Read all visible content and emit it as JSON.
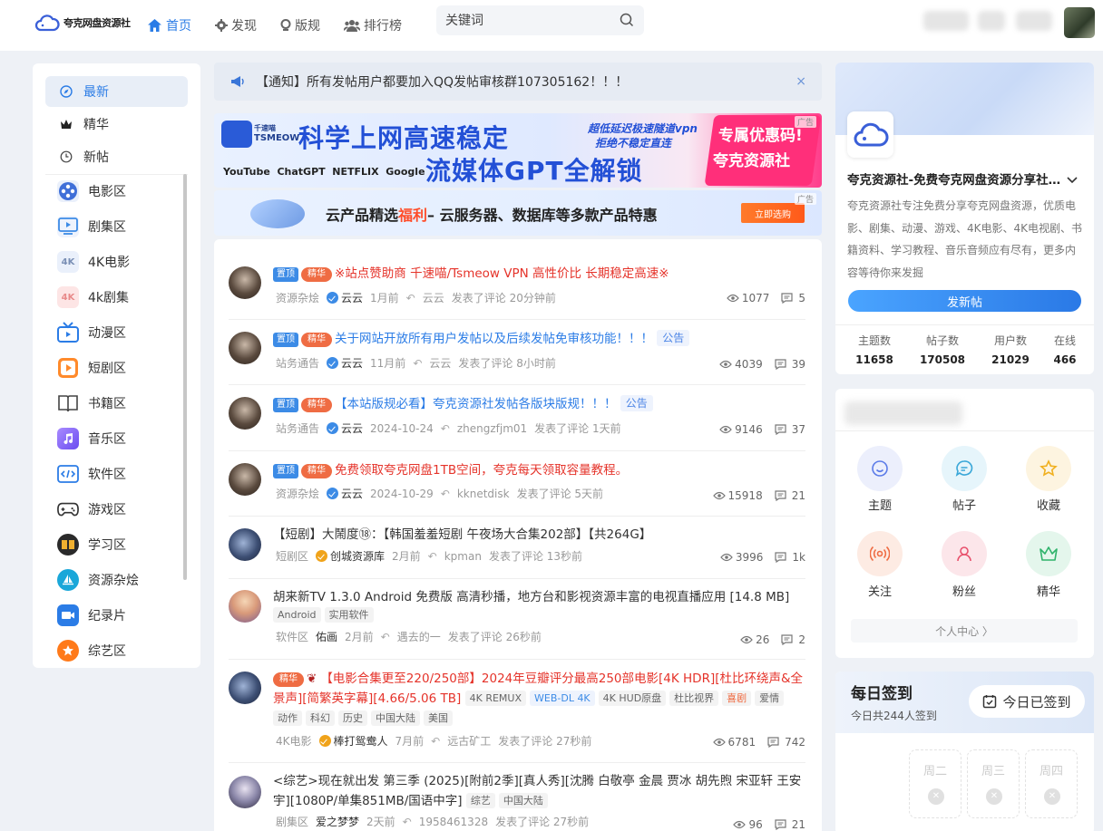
{
  "header": {
    "logo_text": "夸克网盘资源社",
    "nav": [
      {
        "label": "首页",
        "icon": "home-icon",
        "active": true
      },
      {
        "label": "发现",
        "icon": "gear-icon",
        "active": false
      },
      {
        "label": "版规",
        "icon": "pin-icon",
        "active": false
      },
      {
        "label": "排行榜",
        "icon": "users-icon",
        "active": false
      }
    ],
    "search_placeholder": "关键词"
  },
  "left_nav": {
    "items": [
      {
        "label": "最新",
        "icon": "compass-icon",
        "active": true
      },
      {
        "label": "精华",
        "icon": "crown-icon",
        "active": false
      },
      {
        "label": "新帖",
        "icon": "clock-icon",
        "active": false
      }
    ],
    "categories": [
      {
        "label": "电影区",
        "icon": "film-reel-icon",
        "color": "#3f6fd8"
      },
      {
        "label": "剧集区",
        "icon": "tv-play-icon",
        "color": "#3c8be6"
      },
      {
        "label": "4K电影",
        "icon": "4k-icon",
        "icon_text": "4K",
        "color": "#eaf0fb"
      },
      {
        "label": "4k剧集",
        "icon": "4k-red-icon",
        "icon_text": "4K",
        "color": "#fde5e5"
      },
      {
        "label": "动漫区",
        "icon": "tv-anime-icon",
        "color": "#2b7ce6"
      },
      {
        "label": "短剧区",
        "icon": "play-square-icon",
        "color": "#ff8a2b"
      },
      {
        "label": "书籍区",
        "icon": "book-icon",
        "color": "#444444"
      },
      {
        "label": "音乐区",
        "icon": "music-icon",
        "color": "#7b5cf0"
      },
      {
        "label": "软件区",
        "icon": "code-icon",
        "color": "#2b7ce6"
      },
      {
        "label": "游戏区",
        "icon": "gamepad-icon",
        "color": "#333333"
      },
      {
        "label": "学习区",
        "icon": "open-book-icon",
        "color": "#2a2a2a"
      },
      {
        "label": "资源杂烩",
        "icon": "sailboat-icon",
        "color": "#1aa7d9"
      },
      {
        "label": "纪录片",
        "icon": "video-camera-icon",
        "color": "#2b7ce6"
      },
      {
        "label": "综艺区",
        "icon": "star-icon",
        "color": "#ff7a1a"
      }
    ]
  },
  "notice": {
    "text": "【通知】所有发帖用户都要加入QQ发帖审核群107305162！！！",
    "close": "×"
  },
  "banner1": {
    "brand_line1": "千速喵",
    "brand_line2": "TSMEOW",
    "headline1": "科学上网高速稳定",
    "headline2": "流媒体GPT全解锁",
    "sub1": "超低延迟极速隧道vpn",
    "sub2": "拒绝不稳定直连",
    "promo1": "专属优惠码!",
    "promo2": "夸克资源社",
    "services": "YouTube  ChatGPT  NETFLIX  Google",
    "ad": "广告"
  },
  "banner2": {
    "text_a": "云产品精选",
    "text_hl": "福利",
    "text_b": "– 云服务器、数据库等多款产品特惠",
    "button": "立即选购",
    "ad": "广告"
  },
  "posts": [
    {
      "badges": [
        "置顶",
        "精华"
      ],
      "title": "※站点赞助商 千速喵/Tsmeow VPN 高性价比 长期稳定高速※",
      "red": true,
      "category": "资源杂烩",
      "author": "云云",
      "time": "1月前",
      "replier": "云云",
      "reply_text": "发表了评论 20分钟前",
      "views": "1077",
      "comments": "5"
    },
    {
      "badges": [
        "置顶",
        "精华"
      ],
      "title": "关于网站开放所有用户发帖以及后续发帖免审核功能！！！",
      "label": "公告",
      "category": "站务通告",
      "author": "云云",
      "time": "11月前",
      "replier": "云云",
      "reply_text": "发表了评论 8小时前",
      "views": "4039",
      "comments": "39"
    },
    {
      "badges": [
        "置顶",
        "精华"
      ],
      "title": "【本站版规必看】夸克资源社发帖各版块版规！！！",
      "label": "公告",
      "category": "站务通告",
      "author": "云云",
      "time": "2024-10-24",
      "replier": "zhengzfjm01",
      "reply_text": "发表了评论 1天前",
      "views": "9146",
      "comments": "37"
    },
    {
      "badges": [
        "置顶",
        "精华"
      ],
      "title": "免费领取夸克网盘1TB空间，夸克每天领取容量教程。",
      "red": true,
      "category": "资源杂烩",
      "author": "云云",
      "time": "2024-10-29",
      "replier": "kknetdisk",
      "reply_text": "发表了评论 5天前",
      "views": "15918",
      "comments": "21"
    },
    {
      "badges": [],
      "title": "【短剧】大鬧度⑱：【韩国羞羞短剧 午夜场大合集202部】【共264G】",
      "category": "短剧区",
      "author": "创城资源库",
      "time": "2月前",
      "replier": "kpman",
      "reply_text": "发表了评论 13秒前",
      "views": "3996",
      "comments": "1k"
    },
    {
      "badges": [],
      "title": "胡来新TV 1.3.0 Android 免费版 高清秒播，地方台和影视资源丰富的电视直播应用 [14.8 MB]",
      "tags": [
        "Android",
        "实用软件"
      ],
      "category": "软件区",
      "author": "佑画",
      "time": "2月前",
      "replier": "遇去的一",
      "reply_text": "发表了评论 26秒前",
      "views": "26",
      "comments": "2"
    },
    {
      "badges": [
        "精华"
      ],
      "title_line1": "【电影合集更至220/250部】2024年豆瓣评分最高250部电影[4K HDR][杜比环绕声&全",
      "title_line2": "景声][简繁英字幕][4.66/5.06 TB]",
      "tags_inline": [
        "4K REMUX",
        "WEB-DL 4K",
        "4K HUD原盘",
        "杜比视界",
        "喜剧",
        "爱情"
      ],
      "tags": [
        "动作",
        "科幻",
        "历史",
        "中国大陆",
        "美国"
      ],
      "category": "4K电影",
      "author": "棒打鸳鸯人",
      "time": "7月前",
      "replier": "远古矿工",
      "reply_text": "发表了评论 27秒前",
      "views": "6781",
      "comments": "742"
    },
    {
      "badges": [],
      "title_line1": "<综艺>现在就出发 第三季 (2025)[附前2季][真人秀][沈腾 白敬亭 金晨 贾冰 胡先煦 宋亚轩 王安",
      "title_line2": "宇][1080P/单集851MB/国语中字]",
      "tags_inline": [
        "综艺",
        "中国大陆"
      ],
      "category": "剧集区",
      "author": "爱之梦梦",
      "time": "2天前",
      "replier": "1958461328",
      "reply_text": "发表了评论 27秒前",
      "views": "96",
      "comments": "21"
    }
  ],
  "site_card": {
    "title": "夸克资源社-免费夸克网盘资源分享社…",
    "desc": "夸克资源社专注免费分享夸克网盘资源，优质电影、剧集、动漫、游戏、4K电影、4K电视剧、书籍资料、学习教程、音乐音频应有尽有，更多内容等待你来发掘",
    "button": "发新帖",
    "stats": [
      {
        "label": "主题数",
        "value": "11658"
      },
      {
        "label": "帖子数",
        "value": "170508"
      },
      {
        "label": "用户数",
        "value": "21029"
      },
      {
        "label": "在线",
        "value": "466"
      }
    ]
  },
  "user_card": {
    "items": [
      {
        "label": "主题",
        "icon": "smile-icon",
        "color": "#5b7be8",
        "bg": "#eceffc"
      },
      {
        "label": "帖子",
        "icon": "chat-icon",
        "color": "#3aa7d8",
        "bg": "#e6f5fb"
      },
      {
        "label": "收藏",
        "icon": "star-icon",
        "color": "#f0b020",
        "bg": "#fdf4e0"
      },
      {
        "label": "关注",
        "icon": "radio-icon",
        "color": "#ef6c43",
        "bg": "#fdebe3"
      },
      {
        "label": "粉丝",
        "icon": "user-icon",
        "color": "#e8506b",
        "bg": "#fce6ea"
      },
      {
        "label": "精华",
        "icon": "crown-icon",
        "color": "#2fb36b",
        "bg": "#e4f6ec"
      }
    ],
    "center": "个人中心 〉"
  },
  "checkin": {
    "title": "每日签到",
    "sub": "今日共244人签到",
    "button": "今日已签到",
    "days": [
      "周二",
      "周三",
      "周四"
    ]
  }
}
